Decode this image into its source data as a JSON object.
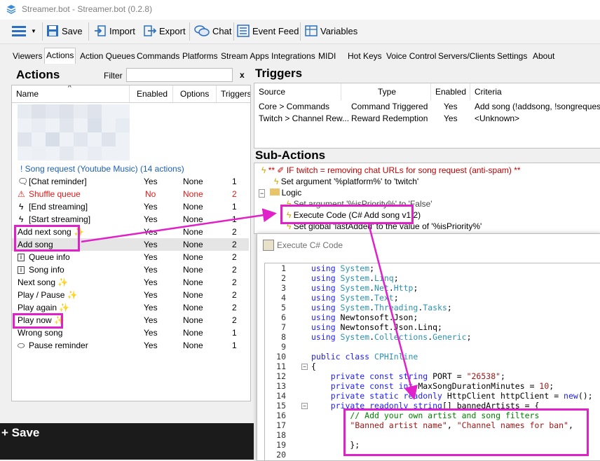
{
  "window": {
    "title": "Streamer.bot - Streamer.bot (0.2.8)"
  },
  "toolbar": {
    "save": "Save",
    "import": "Import",
    "export": "Export",
    "chat": "Chat",
    "event_feed": "Event Feed",
    "variables": "Variables"
  },
  "tabs": [
    "Viewers",
    "Actions",
    "Action Queues",
    "Commands",
    "Platforms",
    "Stream Apps",
    "Integrations",
    "MIDI",
    "Hot Keys",
    "Voice Control",
    "Servers/Clients",
    "Settings",
    "About"
  ],
  "actions": {
    "heading": "Actions",
    "filter_label": "Filter",
    "filter_value": "",
    "clear": "x",
    "columns": [
      "Name",
      "Enabled",
      "Options",
      "Triggers"
    ],
    "group_label": "! Song request (Youtube Music) (14 actions)",
    "rows": [
      {
        "name": "[Chat reminder]",
        "enabled": "Yes",
        "options": "None",
        "triggers": "1",
        "icon": "chat-bubble-icon"
      },
      {
        "name": "Shuffle queue",
        "enabled": "No",
        "options": "None",
        "triggers": "2",
        "icon": "warning-icon"
      },
      {
        "name": "[End streaming]",
        "enabled": "Yes",
        "options": "None",
        "triggers": "1",
        "icon": "bolt-icon"
      },
      {
        "name": "[Start streaming]",
        "enabled": "Yes",
        "options": "None",
        "triggers": "1",
        "icon": "bolt-icon"
      },
      {
        "name": "Add next song ✨",
        "enabled": "Yes",
        "options": "None",
        "triggers": "2",
        "icon": ""
      },
      {
        "name": "Add song",
        "enabled": "Yes",
        "options": "None",
        "triggers": "2",
        "icon": ""
      },
      {
        "name": "Queue info",
        "enabled": "Yes",
        "options": "None",
        "triggers": "2",
        "icon": "info-icon"
      },
      {
        "name": "Song info",
        "enabled": "Yes",
        "options": "None",
        "triggers": "2",
        "icon": "info-icon"
      },
      {
        "name": "Next song ✨",
        "enabled": "Yes",
        "options": "None",
        "triggers": "2",
        "icon": ""
      },
      {
        "name": "Play / Pause ✨",
        "enabled": "Yes",
        "options": "None",
        "triggers": "2",
        "icon": ""
      },
      {
        "name": "Play again ✨",
        "enabled": "Yes",
        "options": "None",
        "triggers": "2",
        "icon": ""
      },
      {
        "name": "Play now ✨",
        "enabled": "Yes",
        "options": "None",
        "triggers": "2",
        "icon": ""
      },
      {
        "name": "Wrong song",
        "enabled": "Yes",
        "options": "None",
        "triggers": "1",
        "icon": ""
      },
      {
        "name": "Pause reminder",
        "enabled": "Yes",
        "options": "None",
        "triggers": "1",
        "icon": "speech-icon"
      }
    ]
  },
  "triggers": {
    "heading": "Triggers",
    "columns": [
      "Source",
      "Type",
      "Enabled",
      "Criteria"
    ],
    "rows": [
      {
        "source": "Core > Commands",
        "type": "Command Triggered",
        "enabled": "Yes",
        "criteria": "Add song (!addsong, !songrequest, ..."
      },
      {
        "source": "Twitch > Channel Rew...",
        "type": "Reward Redemption",
        "enabled": "Yes",
        "criteria": "<Unknown>"
      }
    ]
  },
  "subactions": {
    "heading": "Sub-Actions",
    "items": [
      "** ✐ IF twitch = removing chat URLs for song request (anti-spam) **",
      "Set argument '%platform%' to 'twitch'",
      "Logic",
      "Set argument '%isPriority%' to 'False'",
      "Execute Code (C# Add song v1.2)",
      "Set global 'lastAdded' to the value of '%isPriority%'"
    ]
  },
  "code_window": {
    "title": "Execute C# Code",
    "lines": [
      {
        "n": "1",
        "text": "using System;"
      },
      {
        "n": "2",
        "text": "using System.Linq;"
      },
      {
        "n": "3",
        "text": "using System.Net.Http;"
      },
      {
        "n": "4",
        "text": "using System.Text;"
      },
      {
        "n": "5",
        "text": "using System.Threading.Tasks;"
      },
      {
        "n": "6",
        "text": "using Newtonsoft.Json;"
      },
      {
        "n": "7",
        "text": "using Newtonsoft.Json.Linq;"
      },
      {
        "n": "8",
        "text": "using System.Collections.Generic;"
      },
      {
        "n": "9",
        "text": ""
      },
      {
        "n": "10",
        "text": "public class CPHInline"
      },
      {
        "n": "11",
        "text": "{"
      },
      {
        "n": "12",
        "text": "    private const string PORT = \"26538\";"
      },
      {
        "n": "13",
        "text": "    private const int MaxSongDurationMinutes = 10;"
      },
      {
        "n": "14",
        "text": "    private static readonly HttpClient httpClient = new();"
      },
      {
        "n": "15",
        "text": "    private readonly string[] bannedArtists = {"
      },
      {
        "n": "16",
        "text": "        // Add your own artist and song filters"
      },
      {
        "n": "17",
        "text": "        \"Banned artist name\", \"Channel names for ban\","
      },
      {
        "n": "18",
        "text": ""
      },
      {
        "n": "19",
        "text": "        };"
      },
      {
        "n": "20",
        "text": ""
      }
    ]
  },
  "bottom_save": "Save",
  "colors": {
    "annotation": "#e020c8",
    "disabled_row": "#e01818",
    "group": "#1a5fb4"
  }
}
